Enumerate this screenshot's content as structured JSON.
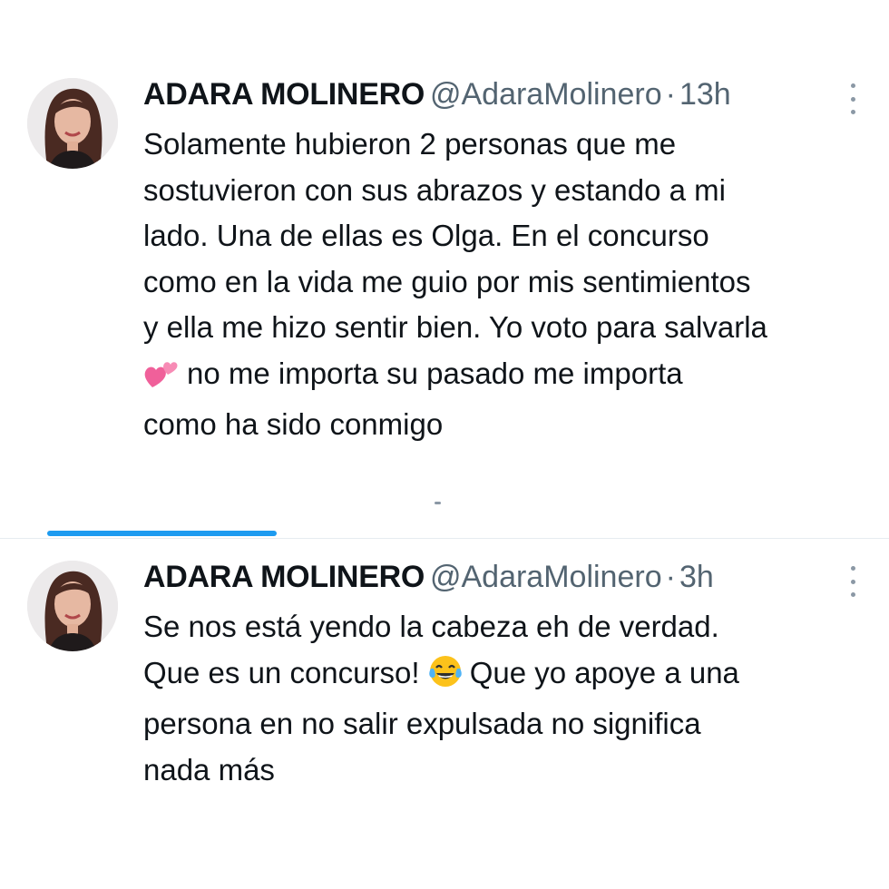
{
  "tweets": [
    {
      "name": "ADARA MOLINERO",
      "handle": "@AdaraMolinero",
      "separator": "·",
      "time": "13h",
      "lines": [
        "Solamente hubieron 2 personas que me",
        "sostuvieron con sus abrazos y estando a mi",
        "lado. Una de ellas es Olga. En el concurso",
        "como en la vida me guio por mis sentimientos",
        "y ella me hizo sentir bien. Yo voto para salvarla",
        "no me importa su pasado me importa",
        "como ha sido conmigo"
      ],
      "emoji": "two-hearts"
    },
    {
      "name": "ADARA MOLINERO",
      "handle": "@AdaraMolinero",
      "separator": "·",
      "time": "3h",
      "lines": [
        "Se nos está yendo la cabeza eh de verdad.",
        "Que es un concurso!",
        "Que yo apoye a una",
        "persona en no salir expulsada no significa",
        "nada más"
      ],
      "emoji": "tears-of-joy"
    }
  ],
  "colors": {
    "text": "#0f1419",
    "secondary": "#536471",
    "accent": "#1d9bf0",
    "divider": "#e6ecf0"
  }
}
